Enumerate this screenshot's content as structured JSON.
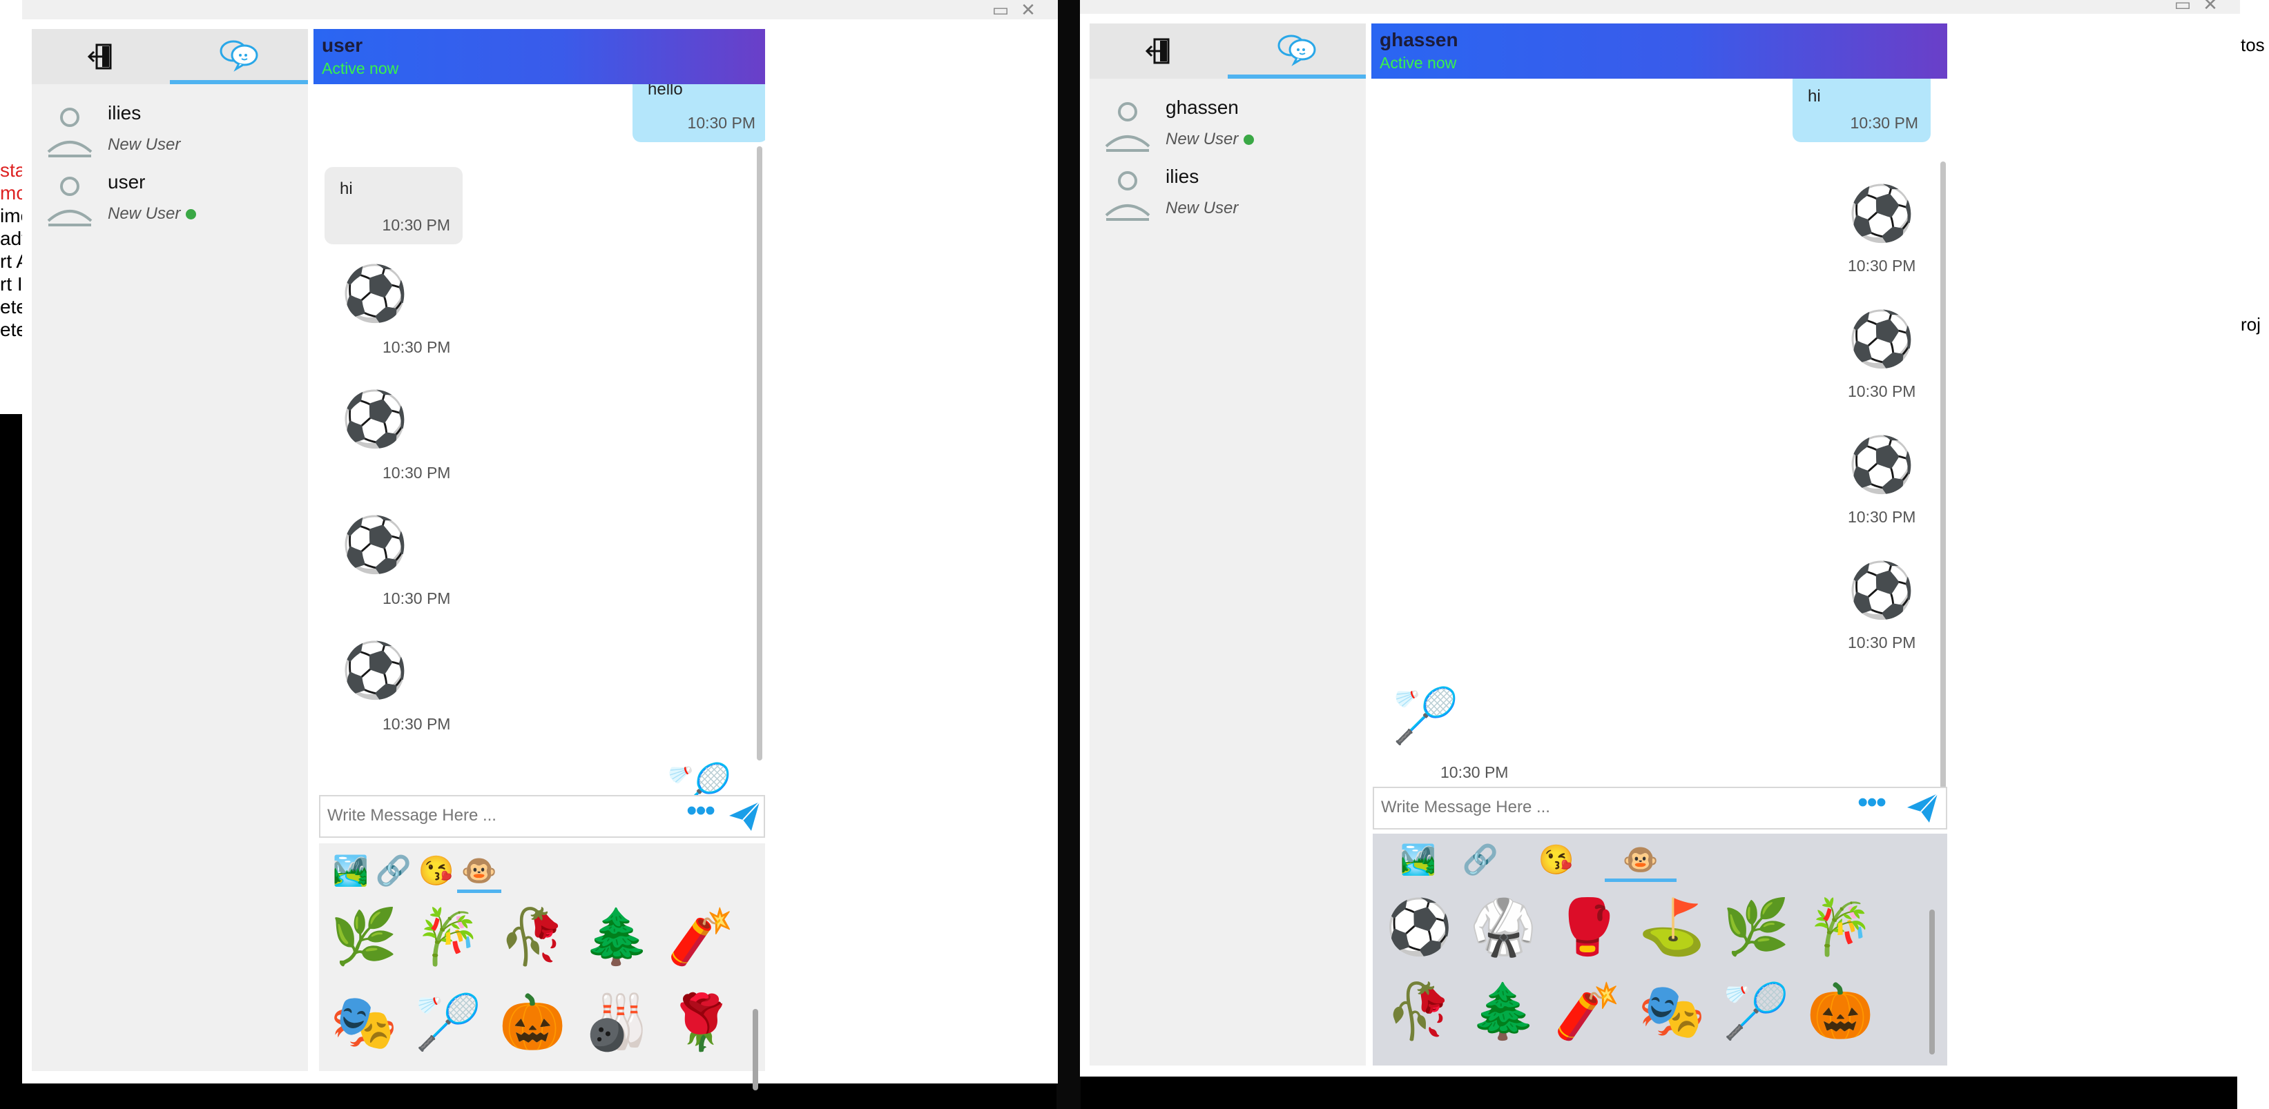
{
  "background": {
    "left_lines": [
      "sta",
      "mc",
      "ime",
      "ady",
      "rt A",
      "rt I",
      "ete",
      "ete"
    ],
    "right_labels": [
      "tos",
      "roj"
    ]
  },
  "windows": [
    {
      "id": "left",
      "tabs": [
        {
          "name": "logout",
          "icon": "logout-icon"
        },
        {
          "name": "chats",
          "icon": "chat-bubbles-icon",
          "active": true
        }
      ],
      "contacts": [
        {
          "name": "ilies",
          "status": "New User",
          "online": false
        },
        {
          "name": "user",
          "status": "New User",
          "online": true
        }
      ],
      "header": {
        "name": "user",
        "status": "Active now"
      },
      "messages": [
        {
          "type": "text",
          "dir": "out",
          "text": "hello",
          "time": "10:30 PM"
        },
        {
          "type": "text",
          "dir": "in",
          "text": "hi",
          "time": "10:30 PM"
        },
        {
          "type": "emoji",
          "dir": "in",
          "emoji": "⚽",
          "time": "10:30 PM"
        },
        {
          "type": "emoji",
          "dir": "in",
          "emoji": "⚽",
          "time": "10:30 PM"
        },
        {
          "type": "emoji",
          "dir": "in",
          "emoji": "⚽",
          "time": "10:30 PM"
        },
        {
          "type": "emoji",
          "dir": "in",
          "emoji": "⚽",
          "time": "10:30 PM"
        },
        {
          "type": "emoji",
          "dir": "out",
          "emoji": "🏸",
          "time": ""
        }
      ],
      "input": {
        "placeholder": "Write Message Here ..."
      },
      "picker_tabs": [
        "🏞️",
        "🔗",
        "😘",
        "🐵"
      ],
      "emoji_grid": [
        "🌿",
        "🎋",
        "🥀",
        "🌲",
        "🧨",
        "🎭",
        "🏸",
        "🎃",
        "🎳",
        "🌹"
      ]
    },
    {
      "id": "right",
      "tabs": [
        {
          "name": "logout",
          "icon": "logout-icon"
        },
        {
          "name": "chats",
          "icon": "chat-bubbles-icon",
          "active": true
        }
      ],
      "contacts": [
        {
          "name": "ghassen",
          "status": "New User",
          "online": true
        },
        {
          "name": "ilies",
          "status": "New User",
          "online": false
        }
      ],
      "header": {
        "name": "ghassen",
        "status": "Active now"
      },
      "messages": [
        {
          "type": "text",
          "dir": "out",
          "text": "hi",
          "time": "10:30 PM"
        },
        {
          "type": "emoji",
          "dir": "out",
          "emoji": "⚽",
          "time": "10:30 PM"
        },
        {
          "type": "emoji",
          "dir": "out",
          "emoji": "⚽",
          "time": "10:30 PM"
        },
        {
          "type": "emoji",
          "dir": "out",
          "emoji": "⚽",
          "time": "10:30 PM"
        },
        {
          "type": "emoji",
          "dir": "out",
          "emoji": "⚽",
          "time": "10:30 PM"
        },
        {
          "type": "emoji",
          "dir": "in",
          "emoji": "🏸",
          "time": "10:30 PM"
        }
      ],
      "input": {
        "placeholder": "Write Message Here ..."
      },
      "picker_tabs": [
        "🏞️",
        "🔗",
        "😘",
        "🐵"
      ],
      "emoji_grid": [
        "⚽",
        "🥋",
        "🥊",
        "⛳",
        "🌿",
        "🎋",
        "🥀",
        "🌲",
        "🧨",
        "🎭",
        "🏸",
        "🎃"
      ]
    }
  ],
  "colors": {
    "accent": "#4fb3f0",
    "header_gradient_start": "#2a66f2",
    "header_gradient_end": "#6a3fc8",
    "active_status": "#39f24a",
    "online_dot": "#3aa845",
    "outgoing_bubble": "#b4e6fb"
  }
}
